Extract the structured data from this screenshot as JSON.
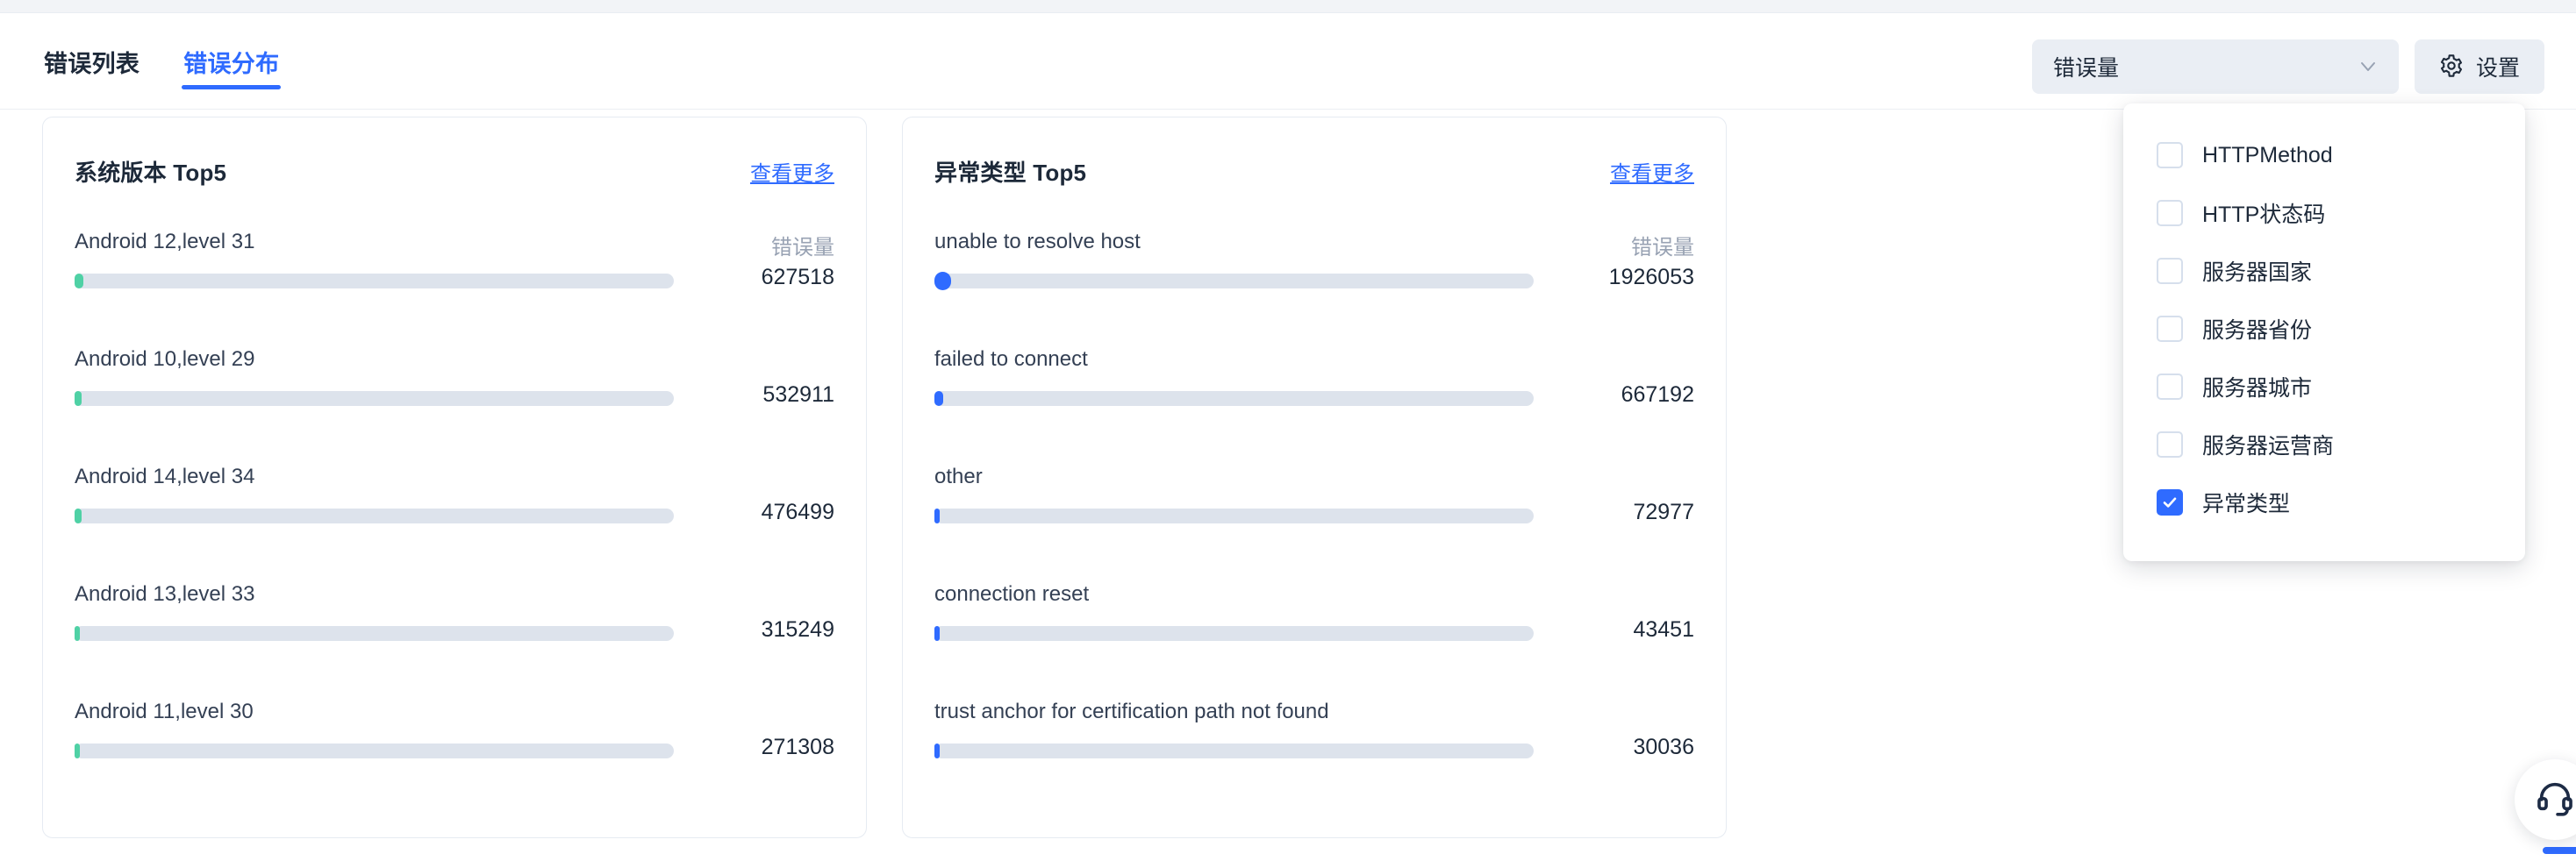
{
  "tabs": [
    {
      "label": "错误列表",
      "active": false,
      "name": "tab-error-list"
    },
    {
      "label": "错误分布",
      "active": true,
      "name": "tab-error-distribution"
    }
  ],
  "toolbar": {
    "metric_select": {
      "value": "错误量",
      "icon": "chevron-down-icon"
    },
    "settings_button": {
      "label": "设置",
      "icon": "gear-icon"
    }
  },
  "dropdown": {
    "items": [
      {
        "label": "HTTPMethod",
        "checked": false
      },
      {
        "label": "HTTP状态码",
        "checked": false
      },
      {
        "label": "服务器国家",
        "checked": false
      },
      {
        "label": "服务器省份",
        "checked": false
      },
      {
        "label": "服务器城市",
        "checked": false
      },
      {
        "label": "服务器运营商",
        "checked": false
      },
      {
        "label": "异常类型",
        "checked": true
      }
    ]
  },
  "cards": [
    {
      "title": "系统版本 Top5",
      "more_label": "查看更多",
      "unit_label": "错误量",
      "accent": "#4fd1a5",
      "rows": [
        {
          "label": "Android 12,level 31",
          "value": "627518",
          "pct": 1.4
        },
        {
          "label": "Android 10,level 29",
          "value": "532911",
          "pct": 1.2
        },
        {
          "label": "Android 14,level 34",
          "value": "476499",
          "pct": 1.1
        },
        {
          "label": "Android 13,level 33",
          "value": "315249",
          "pct": 0.9
        },
        {
          "label": "Android 11,level 30",
          "value": "271308",
          "pct": 0.8
        }
      ]
    },
    {
      "title": "异常类型 Top5",
      "more_label": "查看更多",
      "unit_label": "错误量",
      "accent": "#2f6bff",
      "rows": [
        {
          "label": "unable to resolve host",
          "value": "1926053",
          "pct": 2.8
        },
        {
          "label": "failed to connect",
          "value": "667192",
          "pct": 1.4
        },
        {
          "label": "other",
          "value": "72977",
          "pct": 0.7
        },
        {
          "label": "connection reset",
          "value": "43451",
          "pct": 0.5
        },
        {
          "label": "trust anchor for certification path not found",
          "value": "30036",
          "pct": 0.4
        }
      ]
    }
  ],
  "support_widget": {
    "icon": "headset-icon"
  },
  "chart_data": [
    {
      "type": "bar",
      "title": "系统版本 Top5",
      "xlabel": "",
      "ylabel": "错误量",
      "categories": [
        "Android 12,level 31",
        "Android 10,level 29",
        "Android 14,level 34",
        "Android 13,level 33",
        "Android 11,level 30"
      ],
      "values": [
        627518,
        532911,
        476499,
        315249,
        271308
      ],
      "orientation": "horizontal",
      "grid": false,
      "legend": "none"
    },
    {
      "type": "bar",
      "title": "异常类型 Top5",
      "xlabel": "",
      "ylabel": "错误量",
      "categories": [
        "unable to resolve host",
        "failed to connect",
        "other",
        "connection reset",
        "trust anchor for certification path not found"
      ],
      "values": [
        1926053,
        667192,
        72977,
        43451,
        30036
      ],
      "orientation": "horizontal",
      "grid": false,
      "legend": "none"
    }
  ]
}
